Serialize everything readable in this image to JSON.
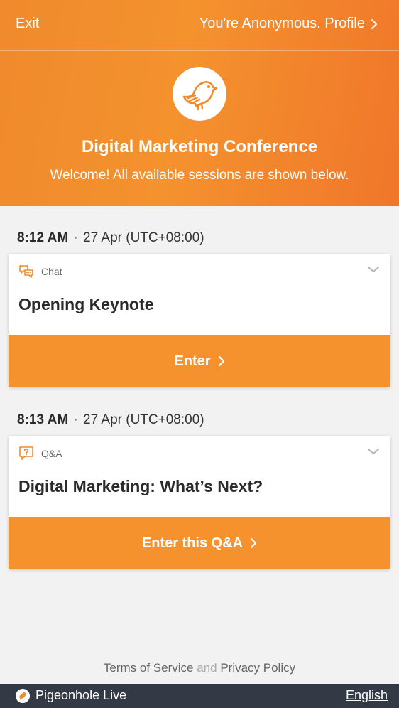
{
  "topbar": {
    "exit_label": "Exit",
    "profile_label": "You're Anonymous. Profile"
  },
  "event": {
    "title": "Digital Marketing Conference",
    "welcome": "Welcome! All available sessions are shown below."
  },
  "sessions": [
    {
      "time": "8:12 AM",
      "date": "27 Apr (UTC+08:00)",
      "type": "Chat",
      "type_icon": "chat-icon",
      "title": "Opening Keynote",
      "enter_label": "Enter"
    },
    {
      "time": "8:13 AM",
      "date": "27 Apr (UTC+08:00)",
      "type": "Q&A",
      "type_icon": "question-icon",
      "title": "Digital Marketing: What’s Next?",
      "enter_label": "Enter this Q&A"
    }
  ],
  "legal": {
    "terms": "Terms of Service",
    "and": "and",
    "privacy": "Privacy Policy"
  },
  "footer": {
    "brand": "Pigeonhole Live",
    "language": "English"
  },
  "colors": {
    "accent": "#f5922e",
    "footer": "#343a45"
  }
}
